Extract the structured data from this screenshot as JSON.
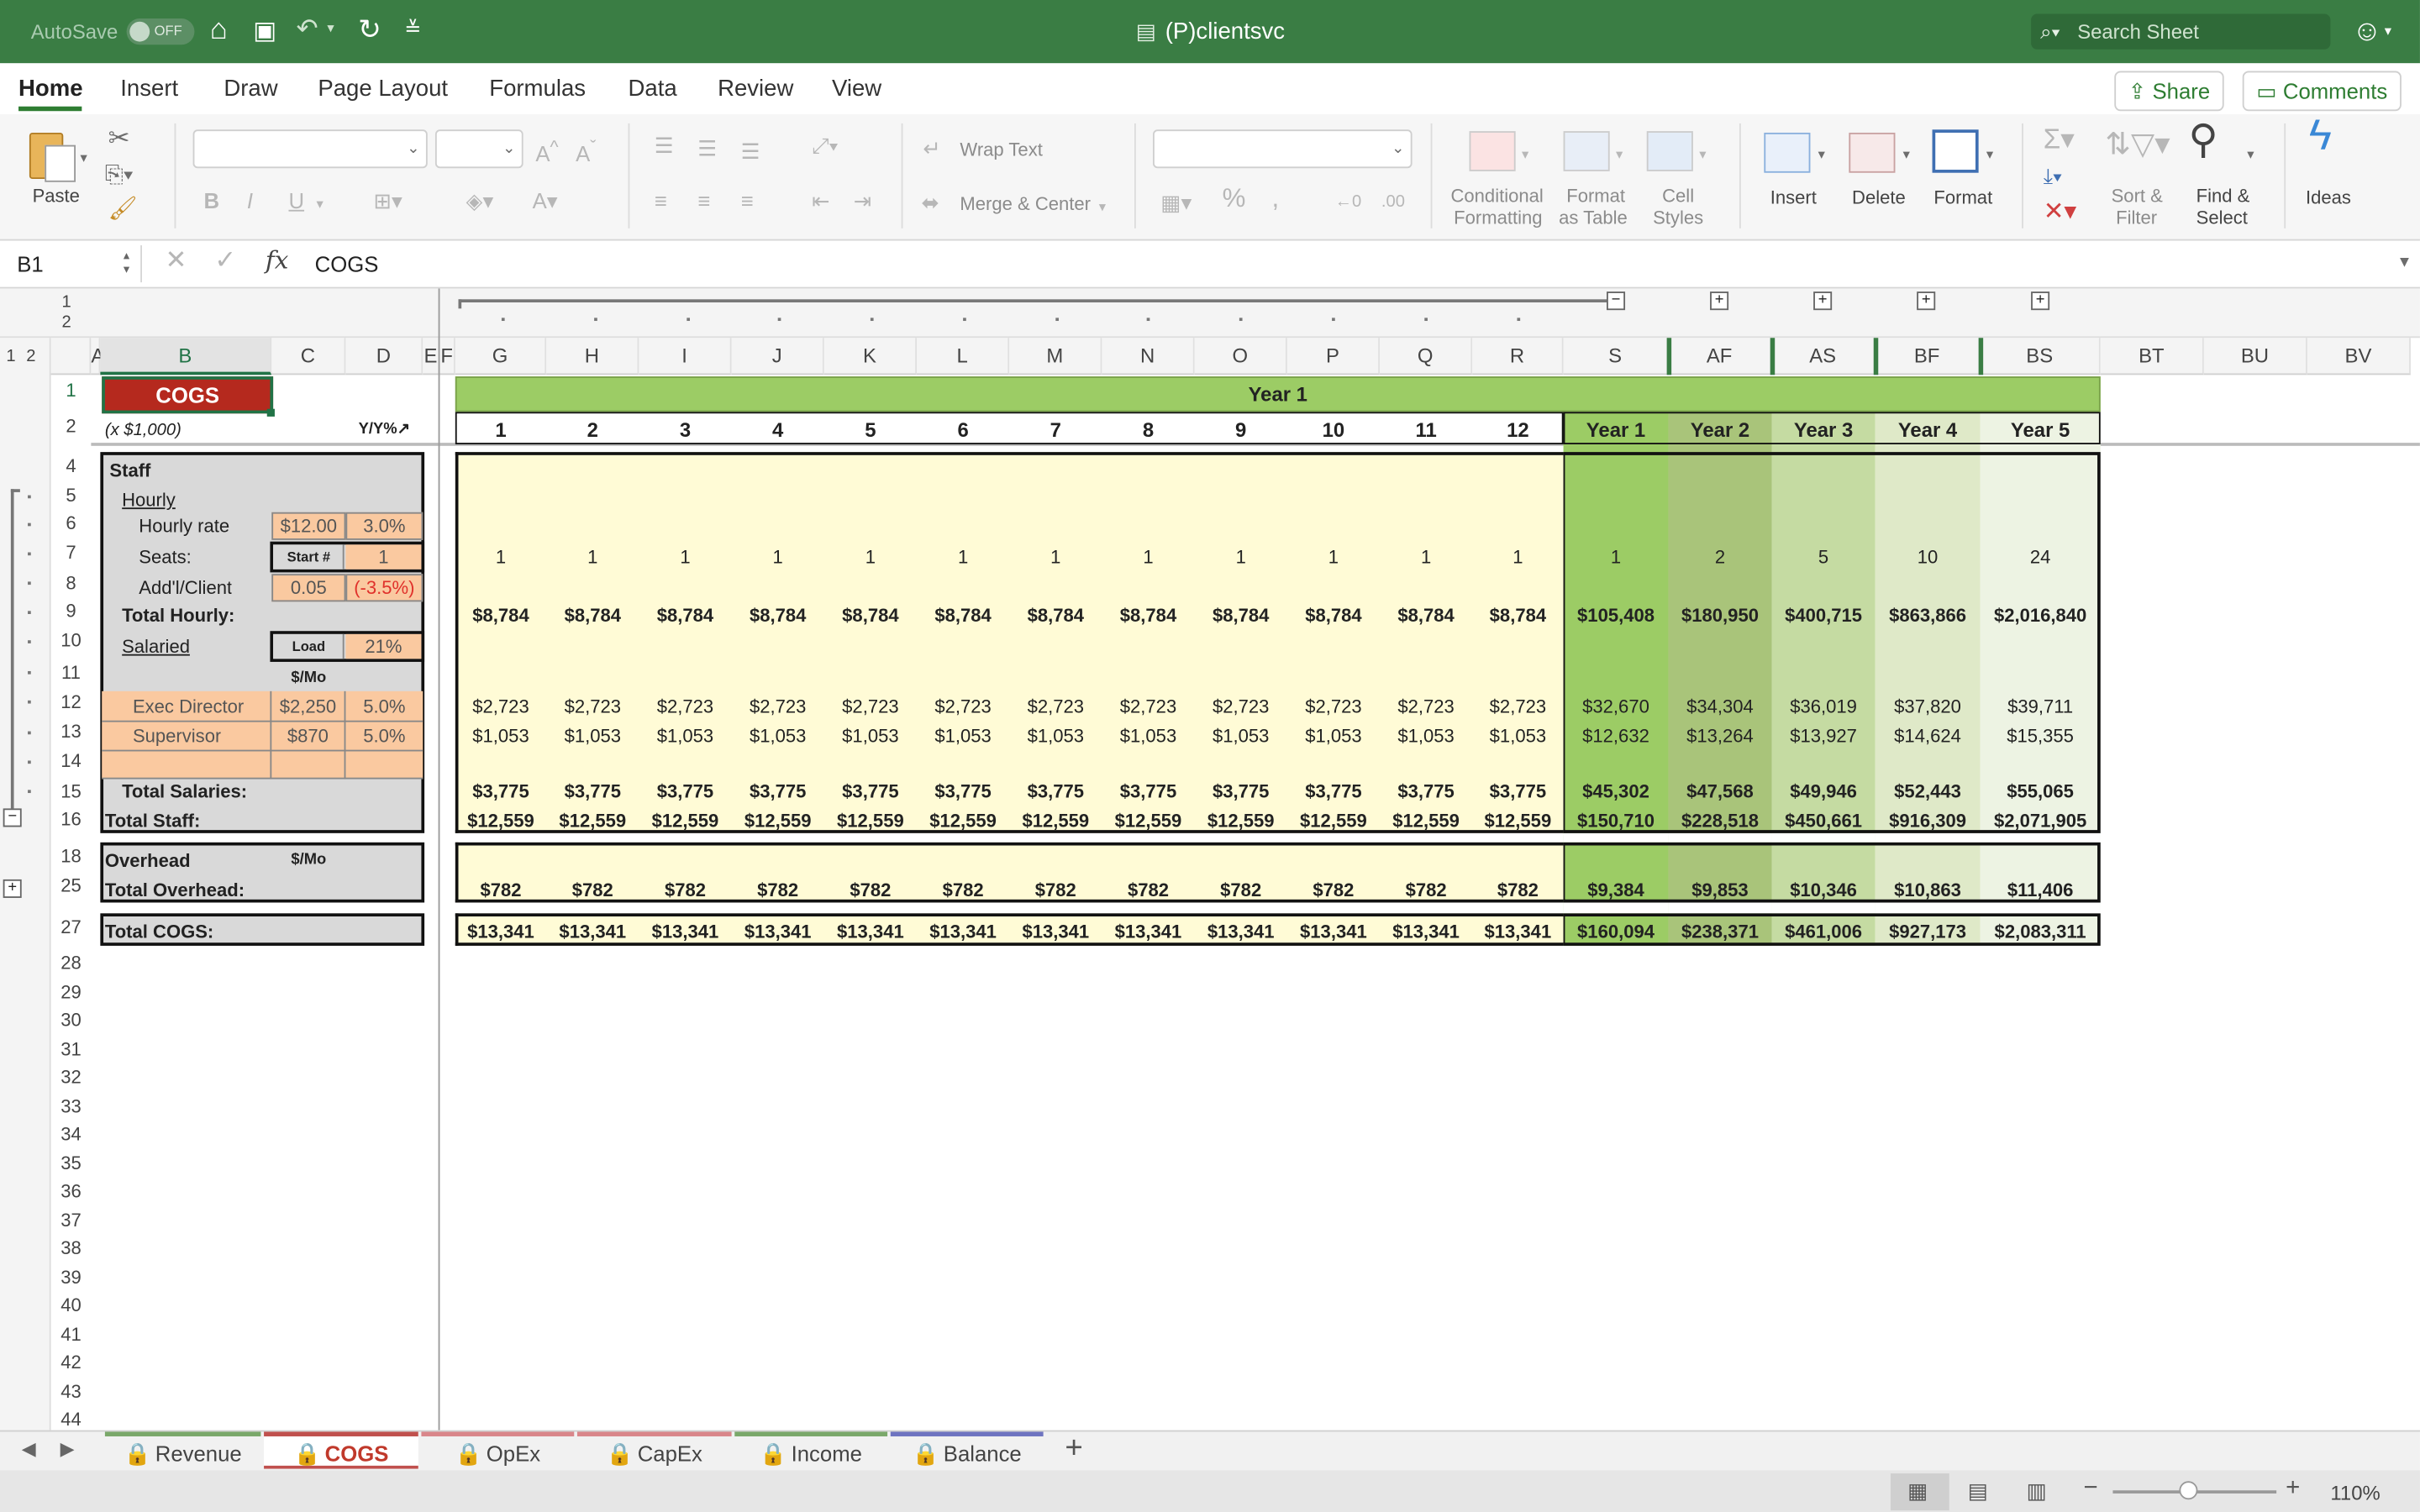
{
  "window": {
    "autosave_label": "AutoSave",
    "autosave_state": "OFF",
    "title": "(P)clientsvc",
    "search_placeholder": "Search Sheet"
  },
  "ribbon_tabs": [
    "Home",
    "Insert",
    "Draw",
    "Page Layout",
    "Formulas",
    "Data",
    "Review",
    "View"
  ],
  "share_label": "Share",
  "comments_label": "Comments",
  "ribbon": {
    "paste": "Paste",
    "wrap_text": "Wrap Text",
    "merge_center": "Merge & Center",
    "conditional": [
      "Conditional",
      "Formatting"
    ],
    "format_table": [
      "Format",
      "as Table"
    ],
    "cell_styles": [
      "Cell",
      "Styles"
    ],
    "insert": "Insert",
    "delete": "Delete",
    "format": "Format",
    "sort_filter": [
      "Sort &",
      "Filter"
    ],
    "find_select": [
      "Find &",
      "Select"
    ],
    "ideas": "Ideas"
  },
  "formula_bar": {
    "name_box": "B1",
    "fx": "fx",
    "content": "COGS"
  },
  "outline": {
    "col_levels": [
      "1",
      "2"
    ],
    "row_levels": [
      "1",
      "2"
    ]
  },
  "columns": [
    "A",
    "B",
    "C",
    "D",
    "E",
    "F",
    "G",
    "H",
    "I",
    "J",
    "K",
    "L",
    "M",
    "N",
    "O",
    "P",
    "Q",
    "R",
    "S",
    "AF",
    "AS",
    "BF",
    "BS",
    "BT",
    "BU",
    "BV"
  ],
  "rows": [
    "1",
    "2",
    "4",
    "5",
    "6",
    "7",
    "8",
    "9",
    "10",
    "11",
    "12",
    "13",
    "14",
    "15",
    "16",
    "18",
    "25",
    "27",
    "28",
    "29",
    "30",
    "31",
    "32",
    "33",
    "34",
    "35",
    "36",
    "37",
    "38",
    "39",
    "40",
    "41",
    "42",
    "43",
    "44"
  ],
  "sheet": {
    "b1": "COGS",
    "b2": "(x $1,000)",
    "d2": "Y/Y%↗",
    "year1_banner": "Year 1",
    "months": [
      "1",
      "2",
      "3",
      "4",
      "5",
      "6",
      "7",
      "8",
      "9",
      "10",
      "11",
      "12"
    ],
    "year_headers": [
      "Year 1",
      "Year 2",
      "Year 3",
      "Year 4",
      "Year 5"
    ],
    "labels": {
      "staff": "Staff",
      "hourly": "Hourly",
      "hourly_rate": "Hourly rate",
      "seats": "Seats:",
      "addl_client": "Add'l/Client",
      "total_hourly": "Total Hourly:",
      "salaried": "Salaried",
      "per_mo": "$/Mo",
      "exec_director": "Exec Director",
      "supervisor": "Supervisor",
      "total_salaries": "Total Salaries:",
      "total_staff": "Total Staff:",
      "overhead": "Overhead",
      "overhead_per_mo": "$/Mo",
      "total_overhead": "Total Overhead:",
      "total_cogs": "Total COGS:"
    },
    "inputs": {
      "hourly_rate": "$12.00",
      "hourly_growth": "3.0%",
      "start_label": "Start #",
      "start_value": "1",
      "addl_client": "0.05",
      "addl_client_growth": "(-3.5%)",
      "load_label": "Load",
      "load_value": "21%",
      "exec_salary": "$2,250",
      "exec_growth": "5.0%",
      "sup_salary": "$870",
      "sup_growth": "5.0%"
    },
    "monthly": {
      "seats": "1",
      "total_hourly": "$8,784",
      "exec": "$2,723",
      "sup": "$1,053",
      "total_salaries": "$3,775",
      "total_staff": "$12,559",
      "total_overhead": "$782",
      "total_cogs": "$13,341"
    },
    "yearly": {
      "seats": [
        "1",
        "2",
        "5",
        "10",
        "24"
      ],
      "total_hourly": [
        "$105,408",
        "$180,950",
        "$400,715",
        "$863,866",
        "$2,016,840"
      ],
      "exec": [
        "$32,670",
        "$34,304",
        "$36,019",
        "$37,820",
        "$39,711"
      ],
      "sup": [
        "$12,632",
        "$13,264",
        "$13,927",
        "$14,624",
        "$15,355"
      ],
      "total_salaries": [
        "$45,302",
        "$47,568",
        "$49,946",
        "$52,443",
        "$55,065"
      ],
      "total_staff": [
        "$150,710",
        "$228,518",
        "$450,661",
        "$916,309",
        "$2,071,905"
      ],
      "total_overhead": [
        "$9,384",
        "$9,853",
        "$10,346",
        "$10,863",
        "$11,406"
      ],
      "total_cogs": [
        "$160,094",
        "$238,371",
        "$461,006",
        "$927,173",
        "$2,083,311"
      ]
    }
  },
  "sheet_tabs": [
    {
      "name": "Revenue",
      "color": "#7aa86a"
    },
    {
      "name": "COGS",
      "color": "#c0504d"
    },
    {
      "name": "OpEx",
      "color": "#d9868a"
    },
    {
      "name": "CapEx",
      "color": "#d9868a"
    },
    {
      "name": "Income",
      "color": "#7aa86a"
    },
    {
      "name": "Balance",
      "color": "#6e74c0"
    }
  ],
  "zoom": "110%",
  "colors": {
    "title_green": "#3a7d44",
    "cogs_red": "#b5291e",
    "year_banner": "#9ccc65",
    "monthly_fill": "#fffbd6",
    "input_orange": "#fac9a0",
    "label_gray": "#d9d9d9",
    "year1": "#9ccc65",
    "year2": "#a9c47a",
    "year3": "#c5dba2",
    "year4": "#dfe9c8",
    "year5": "#edf3e3"
  }
}
